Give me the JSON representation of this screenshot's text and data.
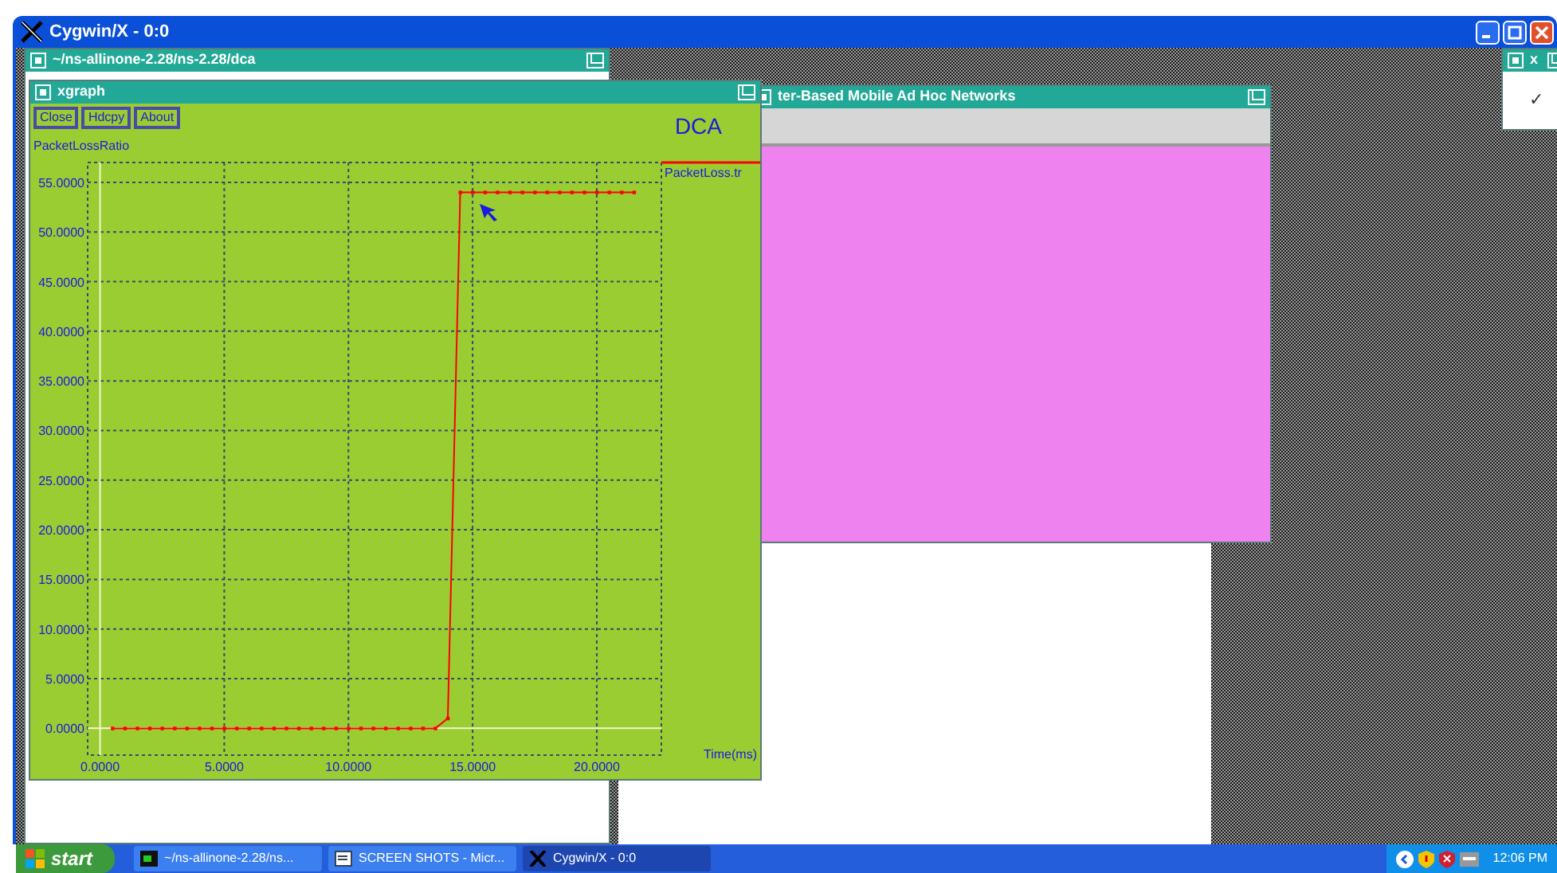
{
  "outer_window": {
    "title": "Cygwin/X - 0:0"
  },
  "terminal_window": {
    "title": "~/ns-allinone-2.28/ns-2.28/dca"
  },
  "nam_window": {
    "title": "ter-Based Mobile Ad Hoc Networks"
  },
  "clock_window": {
    "title": "x",
    "face": "✓"
  },
  "xgraph": {
    "title": "xgraph",
    "buttons": [
      "Close",
      "Hdcpy",
      "About"
    ],
    "chart_data": {
      "type": "line",
      "grid": true,
      "title": "DCA",
      "xlabel": "Time(ms)",
      "ylabel": "PacketLossRatio",
      "x": [
        0.5,
        1,
        1.5,
        2,
        2.5,
        3,
        3.5,
        4,
        4.5,
        5,
        5.5,
        6,
        6.5,
        7,
        7.5,
        8,
        8.5,
        9,
        9.5,
        10,
        10.5,
        11,
        11.5,
        12,
        12.5,
        13,
        13.5,
        14,
        14.5,
        15,
        15.5,
        16,
        16.5,
        17,
        17.5,
        18,
        18.5,
        19,
        19.5,
        20,
        20.5,
        21,
        21.5
      ],
      "series": [
        {
          "name": "PacketLoss.tr",
          "color": "#ff0000",
          "marker": "square",
          "values": [
            0,
            0,
            0,
            0,
            0,
            0,
            0,
            0,
            0,
            0,
            0,
            0,
            0,
            0,
            0,
            0,
            0,
            0,
            0,
            0,
            0,
            0,
            0,
            0,
            0,
            0,
            0,
            1,
            54,
            54,
            54,
            54,
            54,
            54,
            54,
            54,
            54,
            54,
            54,
            54,
            54,
            54,
            54
          ]
        }
      ],
      "xlim": [
        -0.5,
        22.6
      ],
      "ylim": [
        -2.7,
        57
      ],
      "xticks": [
        {
          "value": 0,
          "label": "0.0000"
        },
        {
          "value": 5,
          "label": "5.0000"
        },
        {
          "value": 10,
          "label": "10.0000"
        },
        {
          "value": 15,
          "label": "15.0000"
        },
        {
          "value": 20,
          "label": "20.0000"
        }
      ],
      "yticks": [
        {
          "value": 0,
          "label": "0.0000"
        },
        {
          "value": 5,
          "label": "5.0000"
        },
        {
          "value": 10,
          "label": "10.0000"
        },
        {
          "value": 15,
          "label": "15.0000"
        },
        {
          "value": 20,
          "label": "20.0000"
        },
        {
          "value": 25,
          "label": "25.0000"
        },
        {
          "value": 30,
          "label": "30.0000"
        },
        {
          "value": 35,
          "label": "35.0000"
        },
        {
          "value": 40,
          "label": "40.0000"
        },
        {
          "value": 45,
          "label": "45.0000"
        },
        {
          "value": 50,
          "label": "50.0000"
        },
        {
          "value": 55,
          "label": "55.0000"
        }
      ]
    }
  },
  "taskbar": {
    "start": "start",
    "tasks": [
      {
        "label": "~/ns-allinone-2.28/ns...",
        "kind": "terminal",
        "selected": false
      },
      {
        "label": "SCREEN SHOTS - Micr...",
        "kind": "document",
        "selected": false
      },
      {
        "label": "Cygwin/X - 0:0",
        "kind": "x",
        "selected": true
      }
    ],
    "clock": "12:06 PM"
  }
}
